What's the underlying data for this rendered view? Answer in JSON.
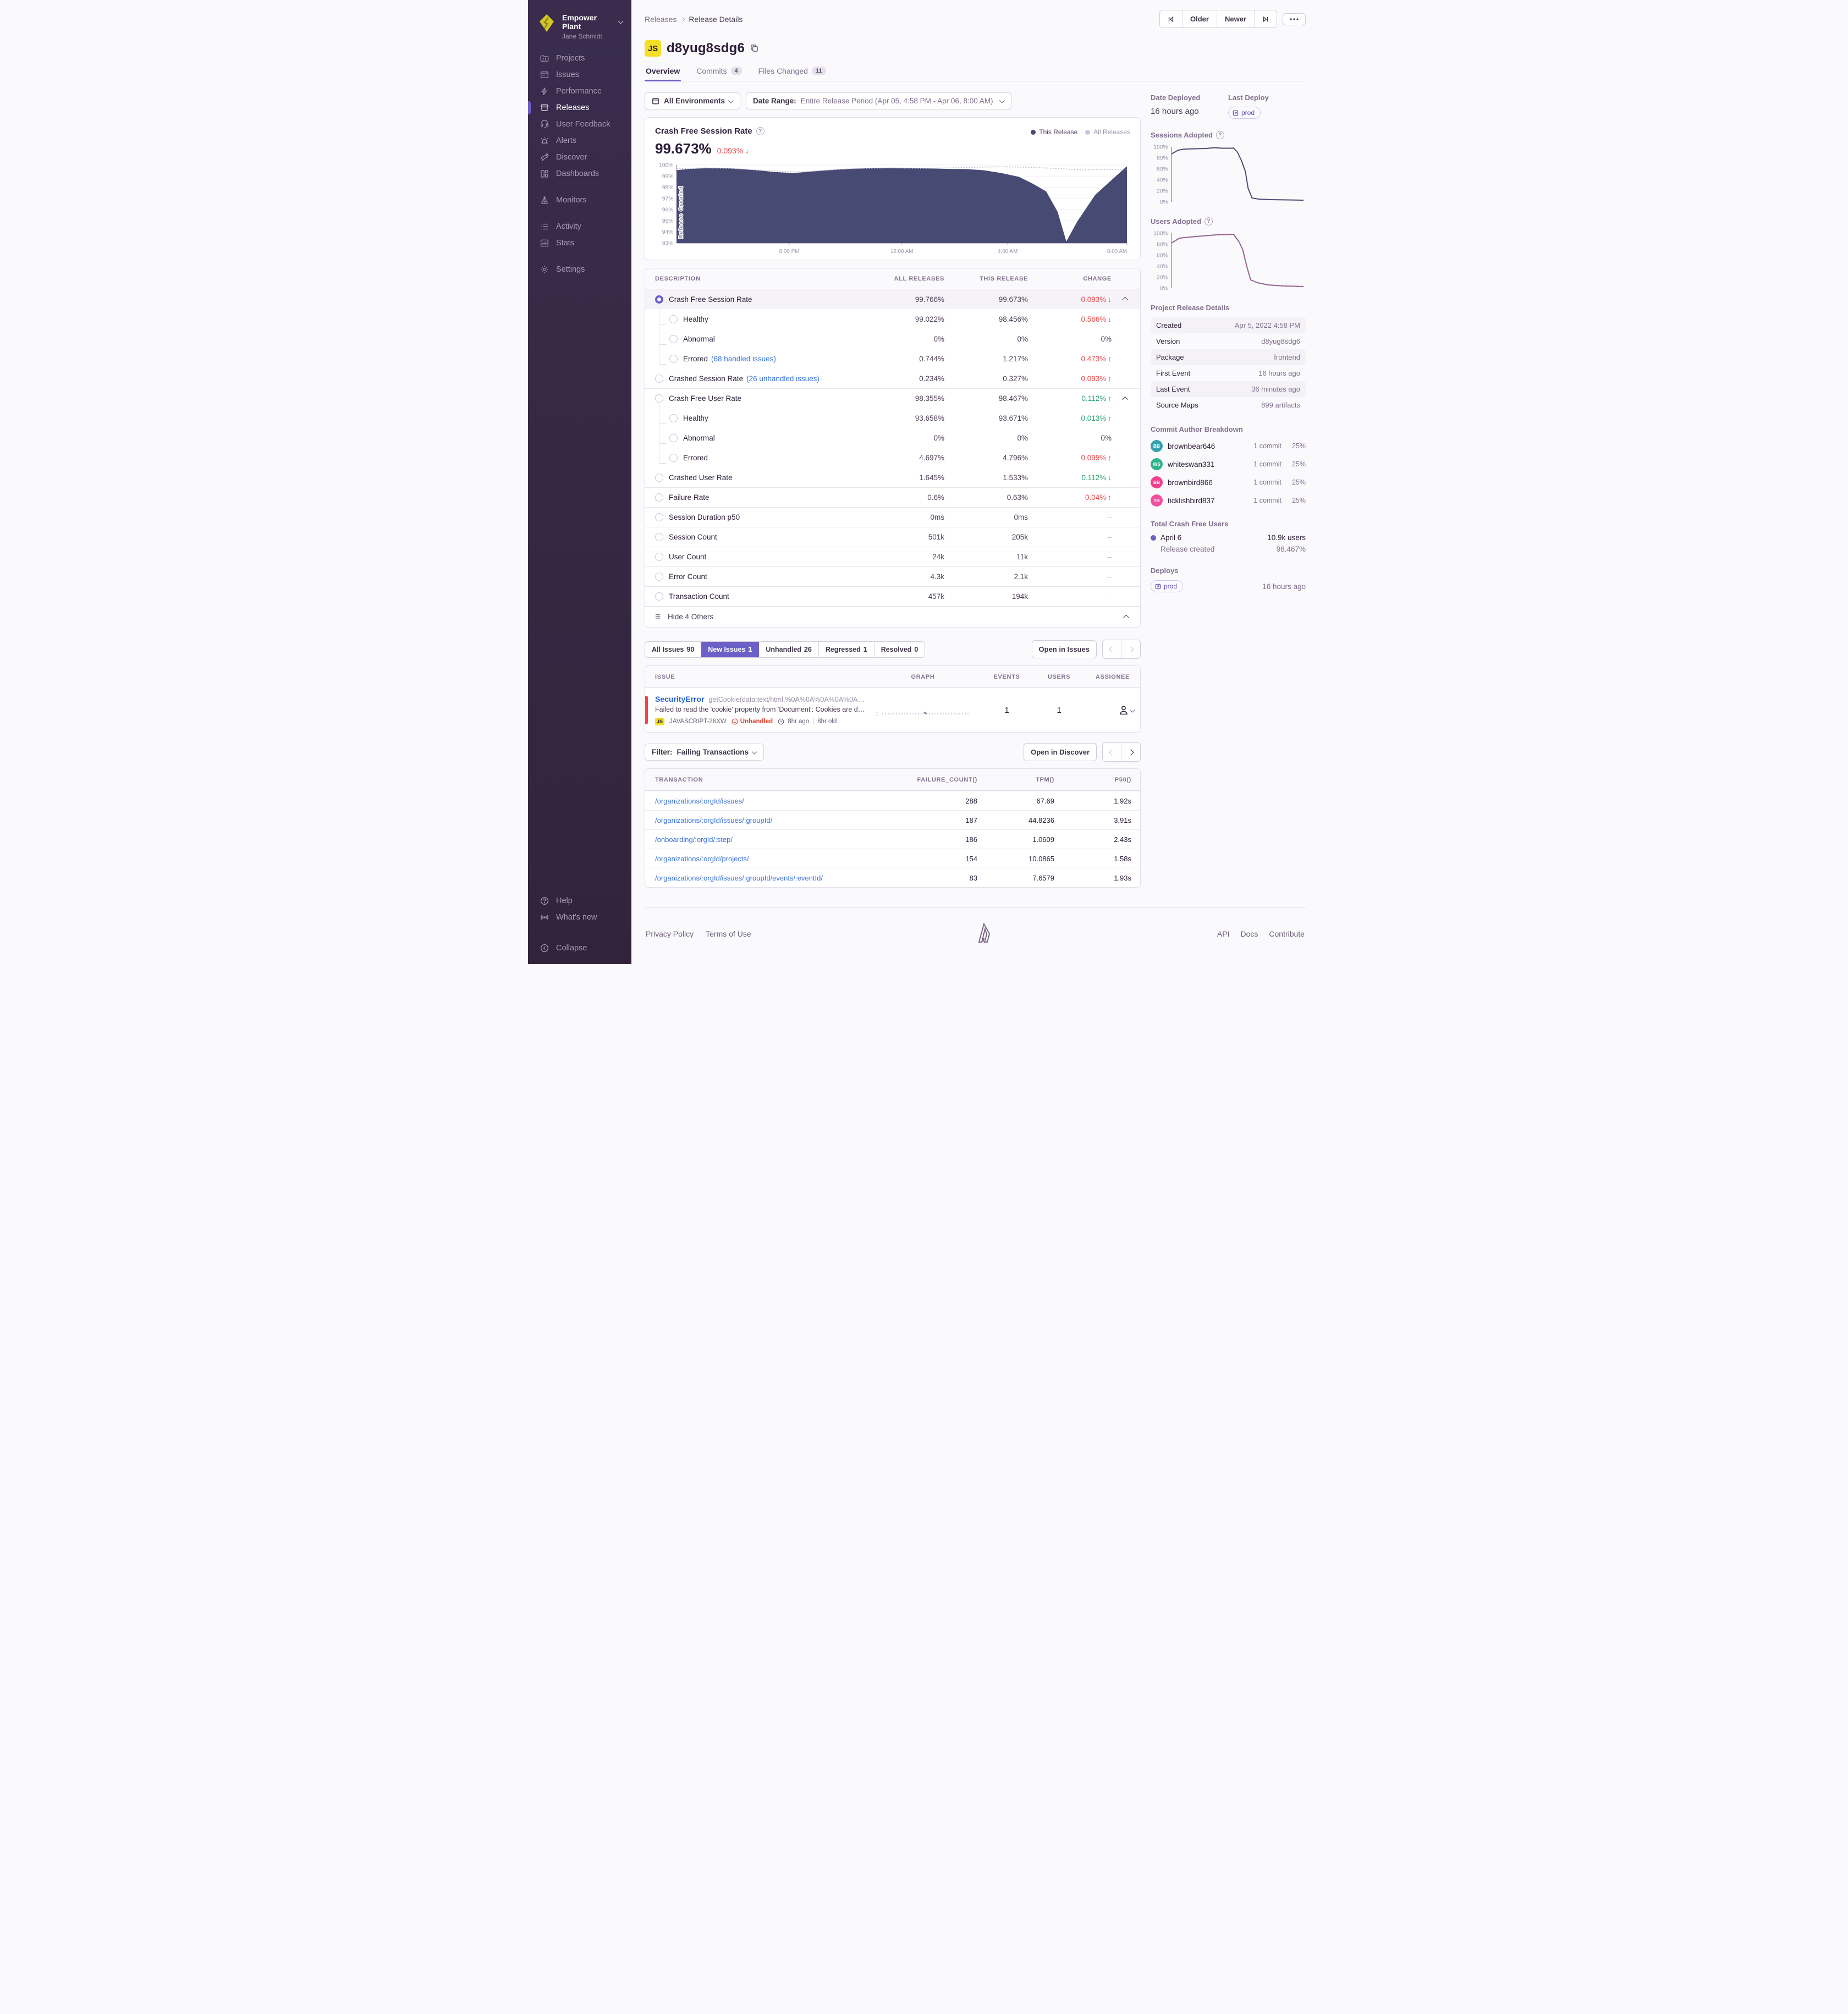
{
  "sidebar": {
    "org": "Empower Plant",
    "user": "Jane Schmidt",
    "items": [
      {
        "label": "Projects"
      },
      {
        "label": "Issues"
      },
      {
        "label": "Performance"
      },
      {
        "label": "Releases"
      },
      {
        "label": "User Feedback"
      },
      {
        "label": "Alerts"
      },
      {
        "label": "Discover"
      },
      {
        "label": "Dashboards"
      },
      {
        "label": "Monitors"
      },
      {
        "label": "Activity"
      },
      {
        "label": "Stats"
      },
      {
        "label": "Settings"
      },
      {
        "label": "Help"
      },
      {
        "label": "What's new"
      },
      {
        "label": "Collapse"
      }
    ]
  },
  "header": {
    "breadcrumb": [
      "Releases",
      "Release Details"
    ],
    "buttons": {
      "older": "Older",
      "newer": "Newer"
    },
    "platform_badge": "JS",
    "title": "d8yug8sdg6",
    "tabs": [
      {
        "label": "Overview",
        "count": ""
      },
      {
        "label": "Commits",
        "count": "4"
      },
      {
        "label": "Files Changed",
        "count": "11"
      }
    ]
  },
  "filters": {
    "environments": "All Environments",
    "date_range_label": "Date Range:",
    "date_range_value": "Entire Release Period (Apr 05, 4:58 PM - Apr 06, 8:00 AM)"
  },
  "chart_header": {
    "title": "Crash Free Session Rate",
    "value": "99.673%",
    "change": "0.093%",
    "change_arrow": "↓",
    "legend": [
      "This Release",
      "All Releases"
    ]
  },
  "chart_data": [
    {
      "name": "crash-free-session-rate",
      "type": "area",
      "title": "Crash Free Session Rate",
      "ylim": [
        93,
        100
      ],
      "yticks": [
        "100%",
        "99%",
        "98%",
        "97%",
        "96%",
        "95%",
        "94%",
        "93%"
      ],
      "xticks": [
        "8:00 PM",
        "12:00 AM",
        "4:00 AM",
        "8:00 AM"
      ],
      "xtick_pos": [
        25,
        50,
        73.5,
        100
      ],
      "annotation": "Release Created",
      "grid": true,
      "legend_position": "top-right",
      "series": [
        {
          "name": "This Release",
          "color": "#474a73",
          "fill": "#474a73",
          "width": 1.5,
          "x": [
            0,
            3,
            7,
            12,
            17,
            22,
            26,
            31,
            37,
            43,
            49,
            55,
            60,
            64,
            68,
            72,
            76,
            79,
            82,
            84.5,
            86.5,
            89,
            93,
            100
          ],
          "values": [
            99.5,
            99.62,
            99.68,
            99.66,
            99.52,
            99.33,
            99.24,
            99.42,
            99.6,
            99.68,
            99.7,
            99.66,
            99.62,
            99.6,
            99.5,
            99.25,
            98.9,
            98.3,
            97.6,
            95.8,
            93.05,
            94.9,
            97.3,
            99.85
          ]
        },
        {
          "name": "All Releases",
          "color": "#bdb1cc",
          "dash": "2 3",
          "width": 1.6,
          "x": [
            0,
            6,
            12,
            18,
            24,
            28,
            34,
            40,
            47,
            54,
            60,
            66,
            72,
            78,
            84,
            90,
            95,
            100
          ],
          "values": [
            99.68,
            99.74,
            99.7,
            99.55,
            99.42,
            99.38,
            99.55,
            99.68,
            99.74,
            99.7,
            99.74,
            99.8,
            99.84,
            99.8,
            99.7,
            99.55,
            99.6,
            99.62
          ]
        }
      ]
    },
    {
      "name": "sessions-adopted",
      "type": "line",
      "title": "Sessions Adopted",
      "ylim": [
        0,
        100
      ],
      "yticks": [
        "100%",
        "80%",
        "60%",
        "40%",
        "20%",
        "0%"
      ],
      "grid": false,
      "series": [
        {
          "name": "Sessions",
          "color": "#4e4a73",
          "width": 2,
          "x": [
            0,
            5,
            10,
            18,
            26,
            33,
            38,
            44,
            47,
            50,
            53,
            56,
            58,
            61,
            66,
            75,
            88,
            100
          ],
          "values": [
            87,
            94,
            96,
            96.5,
            97,
            98.5,
            97.5,
            97.5,
            97.8,
            90,
            75,
            55,
            25,
            7,
            5,
            4,
            3.5,
            3
          ]
        }
      ]
    },
    {
      "name": "users-adopted",
      "type": "line",
      "title": "Users Adopted",
      "ylim": [
        0,
        100
      ],
      "yticks": [
        "100%",
        "80%",
        "60%",
        "40%",
        "20%",
        "0%"
      ],
      "grid": false,
      "series": [
        {
          "name": "Users",
          "color": "#7c6292",
          "width": 2,
          "dash_overlay": "#e4628a",
          "x": [
            0,
            6,
            14,
            24,
            34,
            42,
            47,
            51,
            54,
            57,
            60,
            65,
            73,
            85,
            100
          ],
          "values": [
            82,
            91,
            93,
            95,
            97,
            97.5,
            98,
            85,
            70,
            40,
            15,
            10,
            6,
            4,
            3
          ]
        }
      ]
    }
  ],
  "metrics": {
    "columns": [
      "DESCRIPTION",
      "ALL RELEASES",
      "THIS RELEASE",
      "CHANGE"
    ],
    "rows": [
      {
        "description": "Crash Free Session Rate",
        "all": "99.766%",
        "this": "99.673%",
        "change": "0.093%",
        "arrow": "↓"
      },
      {
        "description": "Healthy",
        "all": "99.022%",
        "this": "98.456%",
        "change": "0.566%",
        "arrow": "↓"
      },
      {
        "description": "Abnormal",
        "all": "0%",
        "this": "0%",
        "change": "0%",
        "arrow": ""
      },
      {
        "description": "Errored",
        "link": "(68 handled issues)",
        "all": "0.744%",
        "this": "1.217%",
        "change": "0.473%",
        "arrow": "↑"
      },
      {
        "description": "Crashed Session Rate",
        "link": "(26 unhandled issues)",
        "all": "0.234%",
        "this": "0.327%",
        "change": "0.093%",
        "arrow": "↑"
      },
      {
        "description": "Crash Free User Rate",
        "all": "98.355%",
        "this": "98.467%",
        "change": "0.112%",
        "arrow": "↑"
      },
      {
        "description": "Healthy",
        "all": "93.658%",
        "this": "93.671%",
        "change": "0.013%",
        "arrow": "↑"
      },
      {
        "description": "Abnormal",
        "all": "0%",
        "this": "0%",
        "change": "0%",
        "arrow": ""
      },
      {
        "description": "Errored",
        "all": "4.697%",
        "this": "4.796%",
        "change": "0.099%",
        "arrow": "↑"
      },
      {
        "description": "Crashed User Rate",
        "all": "1.645%",
        "this": "1.533%",
        "change": "0.112%",
        "arrow": "↓"
      },
      {
        "description": "Failure Rate",
        "all": "0.6%",
        "this": "0.63%",
        "change": "0.04%",
        "arrow": "↑"
      },
      {
        "description": "Session Duration p50",
        "all": "0ms",
        "this": "0ms",
        "change": "–"
      },
      {
        "description": "Session Count",
        "all": "501k",
        "this": "205k",
        "change": "–"
      },
      {
        "description": "User Count",
        "all": "24k",
        "this": "11k",
        "change": "–"
      },
      {
        "description": "Error Count",
        "all": "4.3k",
        "this": "2.1k",
        "change": "–"
      },
      {
        "description": "Transaction Count",
        "all": "457k",
        "this": "194k",
        "change": "–"
      }
    ],
    "footer": "Hide 4 Others"
  },
  "issues": {
    "tabs": [
      {
        "label": "All Issues",
        "count": "90"
      },
      {
        "label": "New Issues",
        "count": "1"
      },
      {
        "label": "Unhandled",
        "count": "26"
      },
      {
        "label": "Regressed",
        "count": "1"
      },
      {
        "label": "Resolved",
        "count": "0"
      }
    ],
    "open_button": "Open in Issues",
    "columns": [
      "ISSUE",
      "GRAPH",
      "EVENTS",
      "USERS",
      "ASSIGNEE"
    ],
    "row": {
      "type": "SecurityError",
      "culprit": "getCookie(data:text/html,%0A%0A%0A%0A%0A%0…",
      "message": "Failed to read the 'cookie' property from 'Document': Cookies are disa…",
      "platform_badge": "JS",
      "project": "JAVASCRIPT-26XW",
      "unhandled": "Unhandled",
      "age": "8hr ago",
      "age2": "8hr old",
      "graph_label": "1",
      "events": "1",
      "users": "1"
    }
  },
  "transactions": {
    "filter_label": "Filter:",
    "filter_value": "Failing Transactions",
    "open_button": "Open in Discover",
    "columns": [
      "TRANSACTION",
      "FAILURE_COUNT()",
      "TPM()",
      "P50()"
    ],
    "rows": [
      {
        "transaction": "/organizations/:orgId/issues/",
        "failure_count": "288",
        "tpm": "67.69",
        "p50": "1.92s"
      },
      {
        "transaction": "/organizations/:orgId/issues/:groupId/",
        "failure_count": "187",
        "tpm": "44.8236",
        "p50": "3.91s"
      },
      {
        "transaction": "/onboarding/:orgId/:step/",
        "failure_count": "186",
        "tpm": "1.0609",
        "p50": "2.43s"
      },
      {
        "transaction": "/organizations/:orgId/projects/",
        "failure_count": "154",
        "tpm": "10.0865",
        "p50": "1.58s"
      },
      {
        "transaction": "/organizations/:orgId/issues/:groupId/events/:eventId/",
        "failure_count": "83",
        "tpm": "7.6579",
        "p50": "1.93s"
      }
    ]
  },
  "side": {
    "date_deployed_label": "Date Deployed",
    "date_deployed": "16 hours ago",
    "last_deploy_label": "Last Deploy",
    "deploy_env": "prod",
    "sessions_adopted_label": "Sessions Adopted",
    "users_adopted_label": "Users Adopted",
    "details_title": "Project Release Details",
    "details": [
      {
        "label": "Created",
        "value": "Apr 5, 2022 4:58 PM"
      },
      {
        "label": "Version",
        "value": "d8yug8sdg6"
      },
      {
        "label": "Package",
        "value": "frontend"
      },
      {
        "label": "First Event",
        "value": "16 hours ago"
      },
      {
        "label": "Last Event",
        "value": "36 minutes ago"
      },
      {
        "label": "Source Maps",
        "value": "899 artifacts"
      }
    ],
    "authors_title": "Commit Author Breakdown",
    "authors": [
      {
        "initials": "BB",
        "name": "brownbear646",
        "commits": "1 commit",
        "pct": "25%",
        "color": "#35a0ae"
      },
      {
        "initials": "WS",
        "name": "whiteswan331",
        "commits": "1 commit",
        "pct": "25%",
        "color": "#2eb489"
      },
      {
        "initials": "BB",
        "name": "brownbird866",
        "commits": "1 commit",
        "pct": "25%",
        "color": "#f0418c"
      },
      {
        "initials": "TB",
        "name": "ticklishbird837",
        "commits": "1 commit",
        "pct": "25%",
        "color": "#f051a2"
      }
    ],
    "crash_free_title": "Total Crash Free Users",
    "crash_free_date": "April 6",
    "crash_free_users": "10.9k users",
    "crash_free_sub": "Release created",
    "crash_free_pct": "98.467%",
    "deploys_title": "Deploys",
    "deploy_time": "16 hours ago"
  },
  "footer": {
    "links_left": [
      "Privacy Policy",
      "Terms of Use"
    ],
    "links_right": [
      "API",
      "Docs",
      "Contribute"
    ]
  },
  "colors": {
    "accent": "#6c5fc7",
    "chart_navy": "#474a73",
    "all_releases_line": "#bdb1cc",
    "red": "#ee4748",
    "green": "#23a46e",
    "link_blue": "#3c74dd",
    "platform_yellow": "#f5df25"
  }
}
